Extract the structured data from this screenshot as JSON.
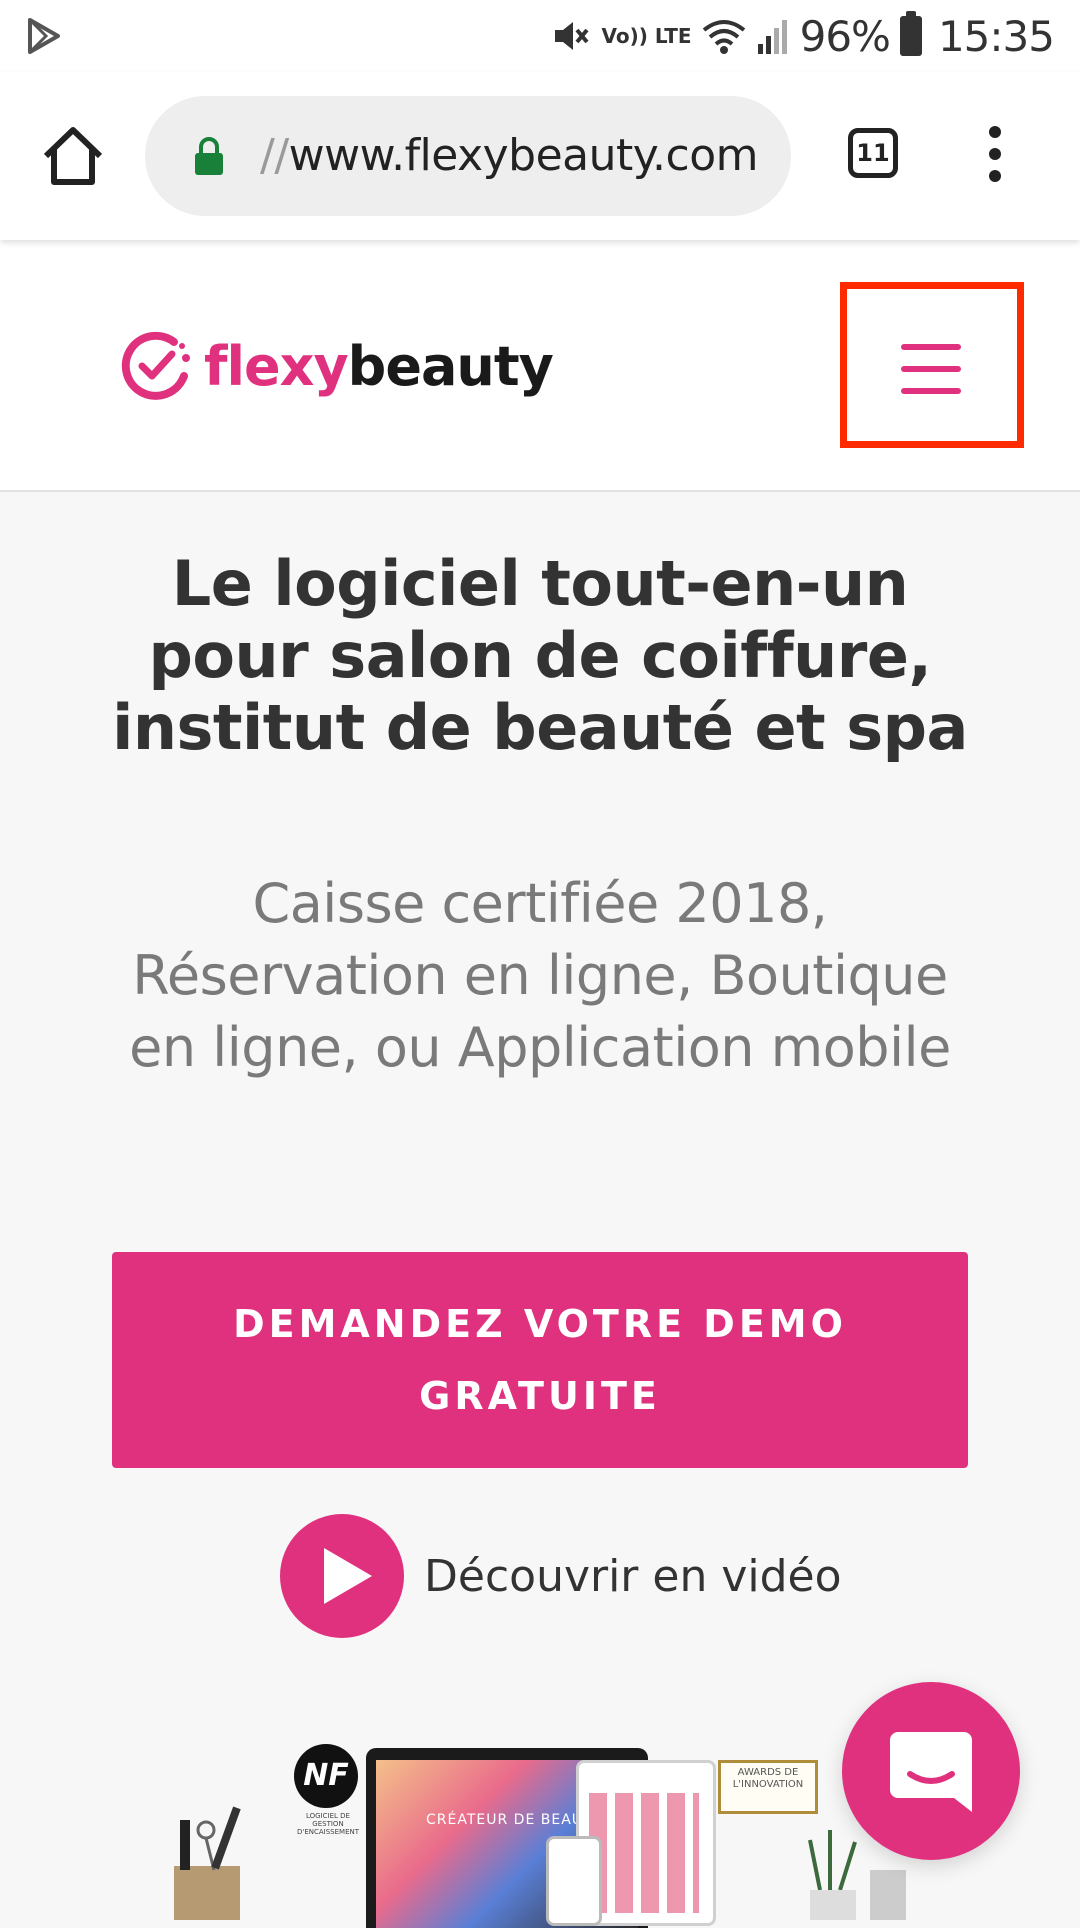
{
  "status_bar": {
    "battery_percent": "96%",
    "time": "15:35",
    "network_label": "Vo)) LTE"
  },
  "browser": {
    "url_scheme": "//",
    "url_host": "www.flexybeauty.com",
    "tab_count": "11"
  },
  "site": {
    "logo_part1": "flexy",
    "logo_part2": "beauty",
    "brand_color": "#e0317f"
  },
  "hero": {
    "title_line1": "Le logiciel tout-en-un",
    "title_line2": "pour salon de coiffure,",
    "title_line3": "institut de beauté et spa",
    "subtitle_line1": "Caisse certifiée 2018,",
    "subtitle_line2": "Réservation en ligne, Boutique",
    "subtitle_line3": "en ligne, ou Application mobile",
    "cta_line1": "DEMANDEZ VOTRE DEMO",
    "cta_line2": "GRATUITE",
    "video_label": "Découvrir en vidéo"
  },
  "illustration": {
    "laptop_caption": "CRÉATEUR DE BEAUTÉ",
    "nf_badge": "NF",
    "nf_caption": "LOGICIEL DE GESTION D'ENCAISSEMENT",
    "award_line1": "AWARDS DE",
    "award_line2": "L'INNOVATION"
  }
}
